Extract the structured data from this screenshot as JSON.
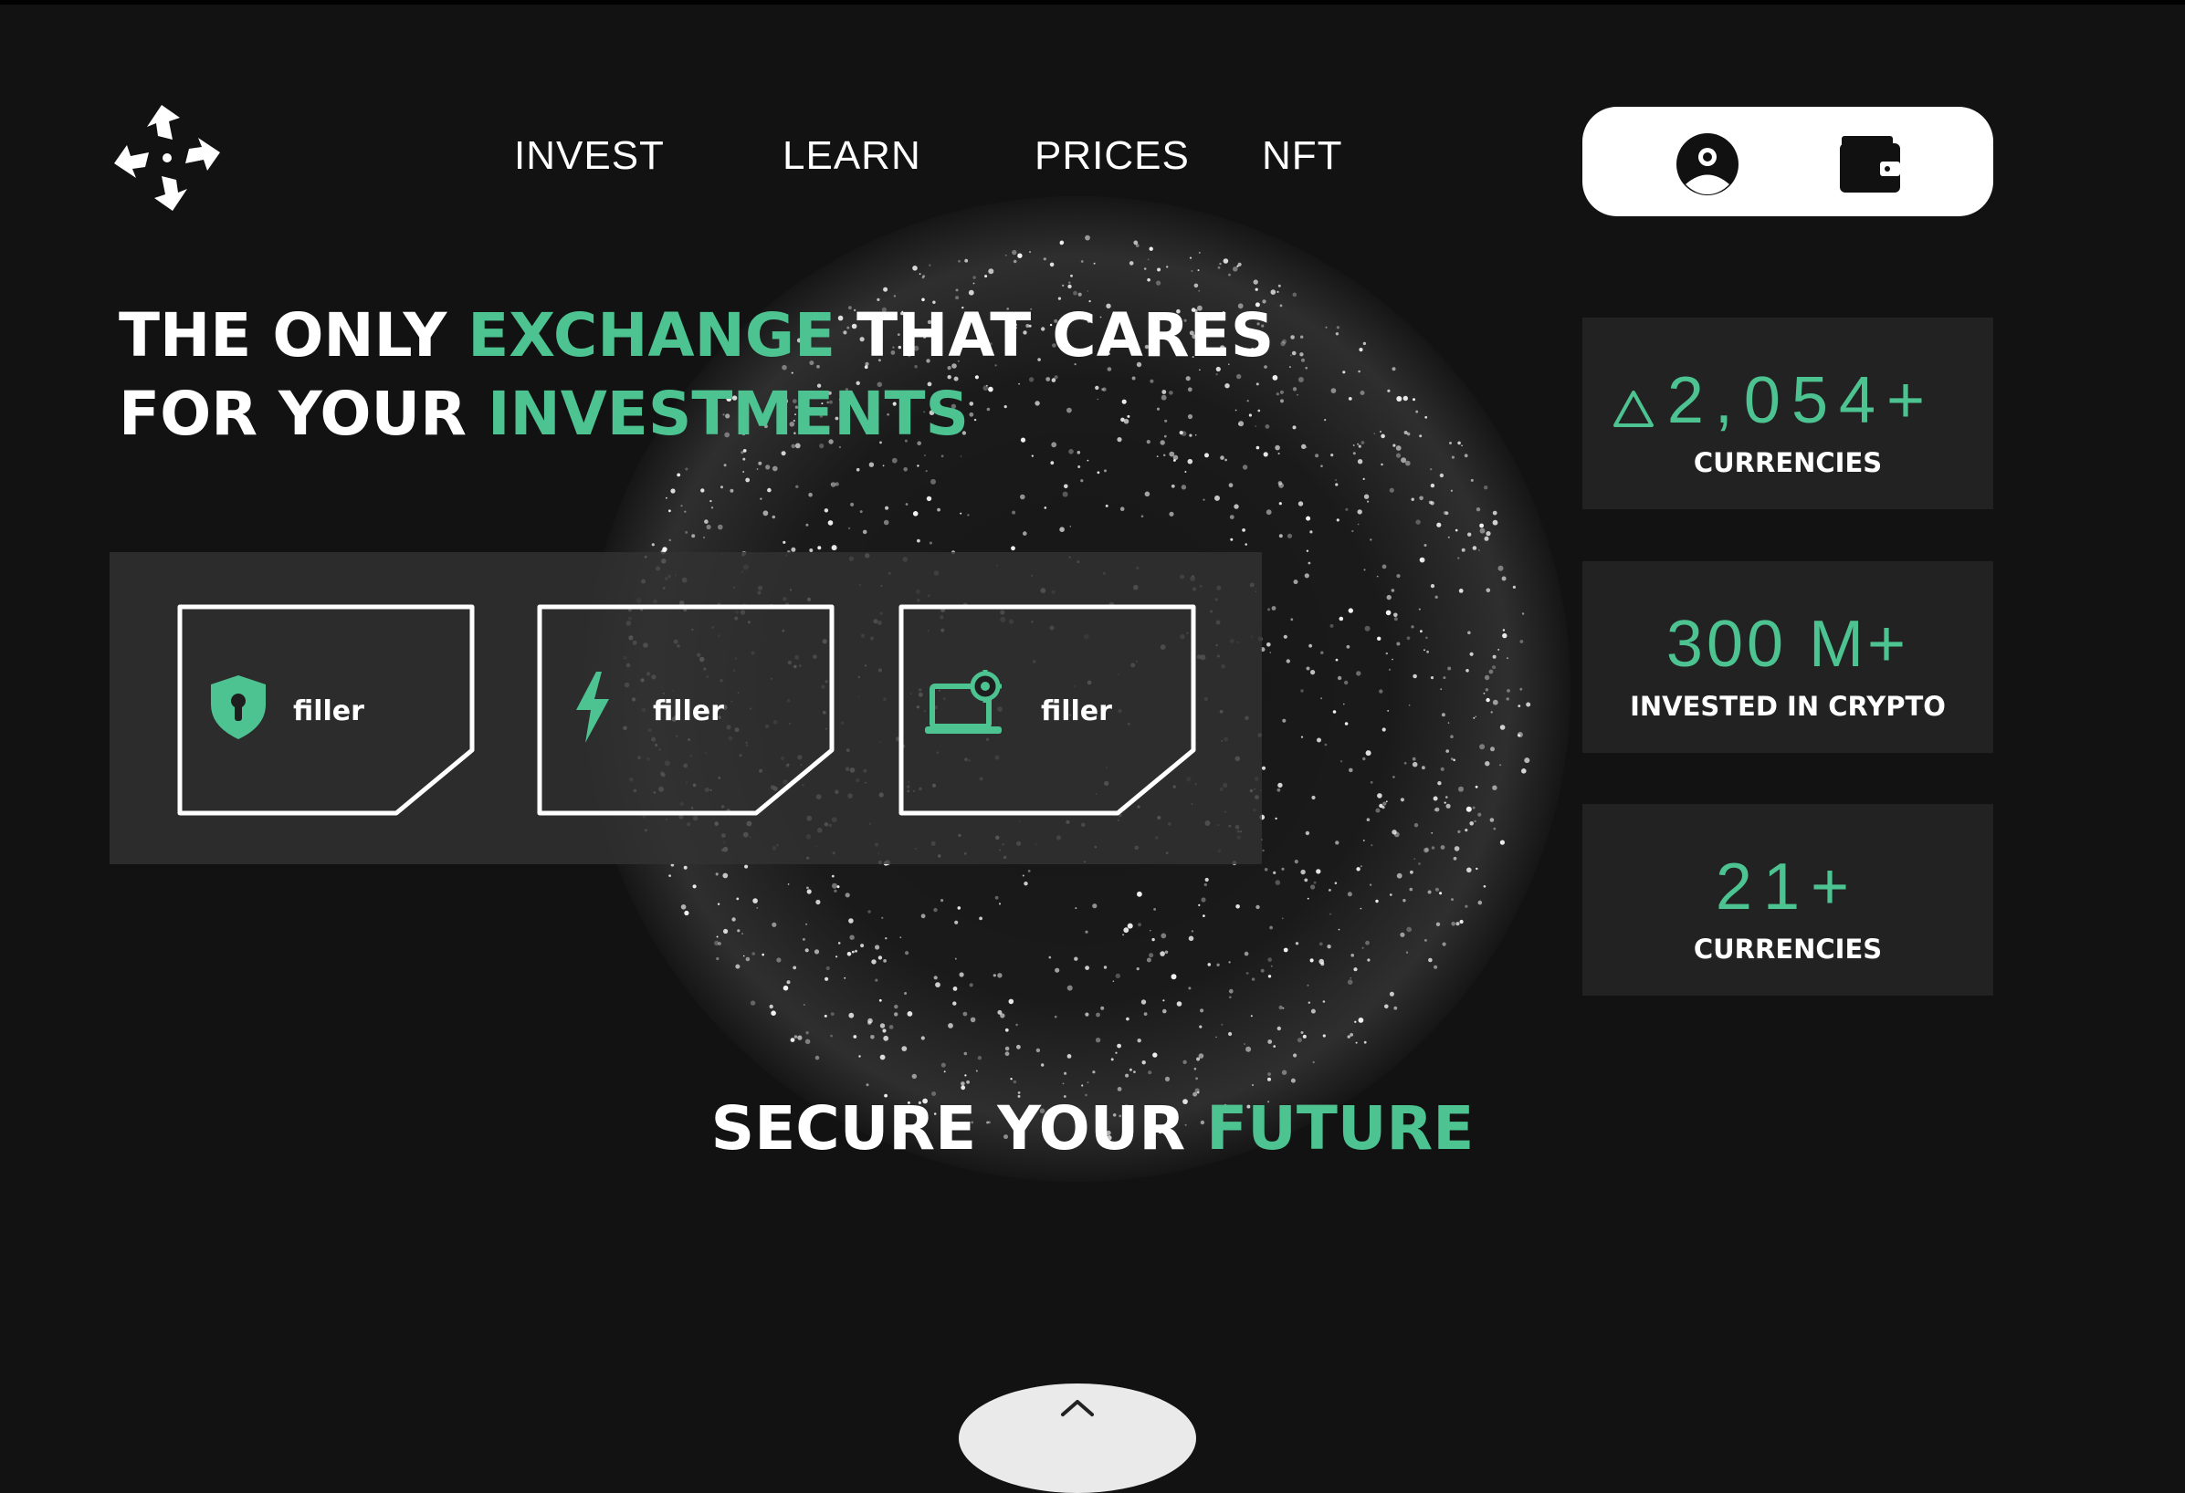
{
  "brand": {
    "logo_icon": "pinwheel-logo-icon"
  },
  "nav": {
    "items": [
      {
        "label": "INVEST"
      },
      {
        "label": "LEARN"
      },
      {
        "label": "PRICES"
      },
      {
        "label": "NFT"
      }
    ]
  },
  "actions": {
    "account_icon": "user-circle-icon",
    "wallet_icon": "wallet-icon"
  },
  "hero": {
    "line1": {
      "a": "THE ONLY",
      "b": "EXCHANGE",
      "c": "THAT CARES"
    },
    "line2": {
      "a": "FOR YOUR",
      "b": "INVESTMENTS"
    }
  },
  "features": [
    {
      "label": "filler",
      "icon": "shield-lock-icon"
    },
    {
      "label": "filler",
      "icon": "lightning-bolt-icon"
    },
    {
      "label": "filler",
      "icon": "laptop-gear-icon"
    }
  ],
  "stats": [
    {
      "value": "2,054+",
      "caption": "CURRENCIES",
      "icon": "triangle-up-icon"
    },
    {
      "value": "300 M+",
      "caption": "INVESTED IN CRYPTO"
    },
    {
      "value": "21+",
      "caption": "CURRENCIES"
    }
  ],
  "tagline": {
    "a": "SECURE YOUR",
    "b": "FUTURE"
  },
  "colors": {
    "accent": "#4cc391",
    "background": "#121212",
    "panel": "#222222"
  }
}
